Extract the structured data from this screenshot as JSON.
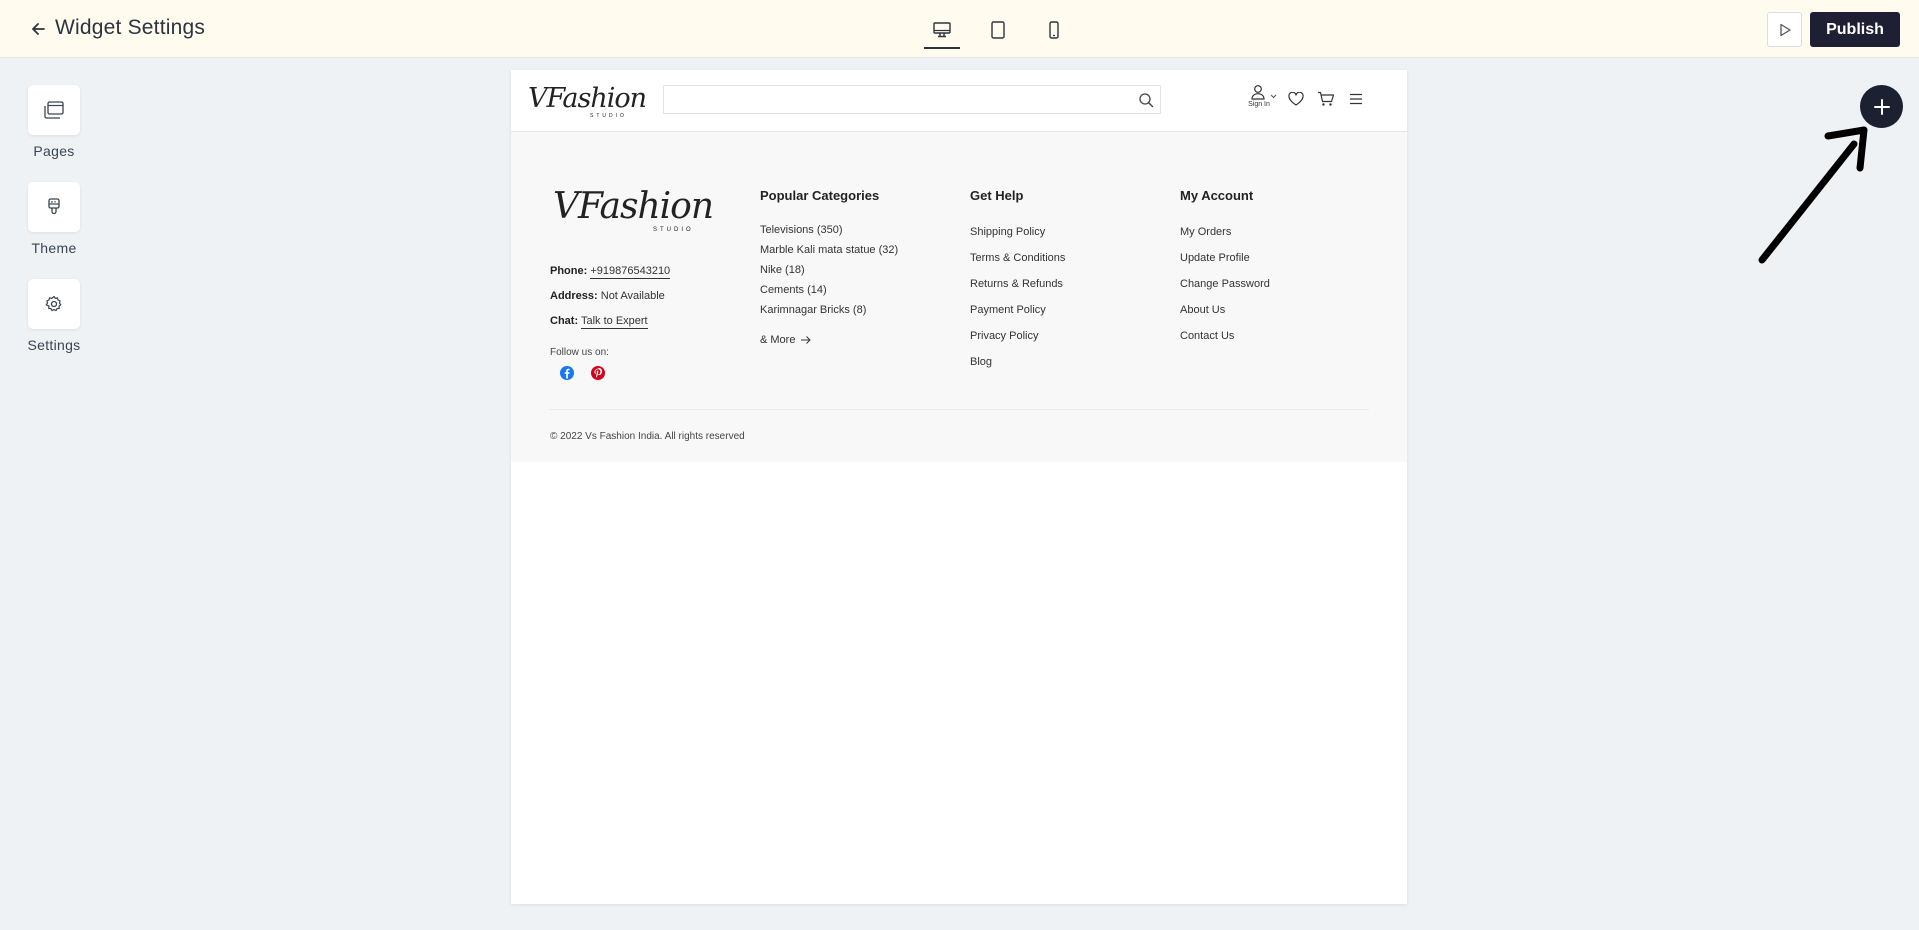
{
  "topbar": {
    "title": "Widget Settings",
    "devices": [
      "desktop",
      "tablet",
      "mobile"
    ],
    "active_device": "desktop",
    "publish_label": "Publish"
  },
  "sidebar": {
    "items": [
      {
        "label": "Pages",
        "icon": "pages-icon"
      },
      {
        "label": "Theme",
        "icon": "theme-icon"
      },
      {
        "label": "Settings",
        "icon": "gear-icon"
      }
    ]
  },
  "site": {
    "logo_main": "VFashion",
    "logo_sub": "STUDIO",
    "search_placeholder": "",
    "signin_label": "Sign In"
  },
  "footer": {
    "contact": {
      "phone_label": "Phone:",
      "phone_value": "+919876543210",
      "address_label": "Address:",
      "address_value": "Not Available",
      "chat_label": "Chat:",
      "chat_value": "Talk to Expert",
      "follow_label": "Follow us on:"
    },
    "popular": {
      "heading": "Popular Categories",
      "items": [
        "Televisions (350)",
        "Marble Kali mata statue (32)",
        "Nike (18)",
        "Cements (14)",
        "Karimnagar Bricks (8)"
      ],
      "more": "& More"
    },
    "help": {
      "heading": "Get Help",
      "items": [
        "Shipping Policy",
        "Terms & Conditions",
        "Returns & Refunds",
        "Payment Policy",
        "Privacy Policy",
        "Blog"
      ]
    },
    "account": {
      "heading": "My Account",
      "items": [
        "My Orders",
        "Update Profile",
        "Change Password",
        "About Us",
        "Contact Us"
      ]
    },
    "copyright": "© 2022 Vs Fashion India. All rights reserved"
  },
  "colors": {
    "topbar_bg": "#fffbee",
    "publish_bg": "#1f1f33",
    "add_button_bg": "#1b2130",
    "facebook": "#1877f2",
    "pinterest": "#d0021b"
  }
}
